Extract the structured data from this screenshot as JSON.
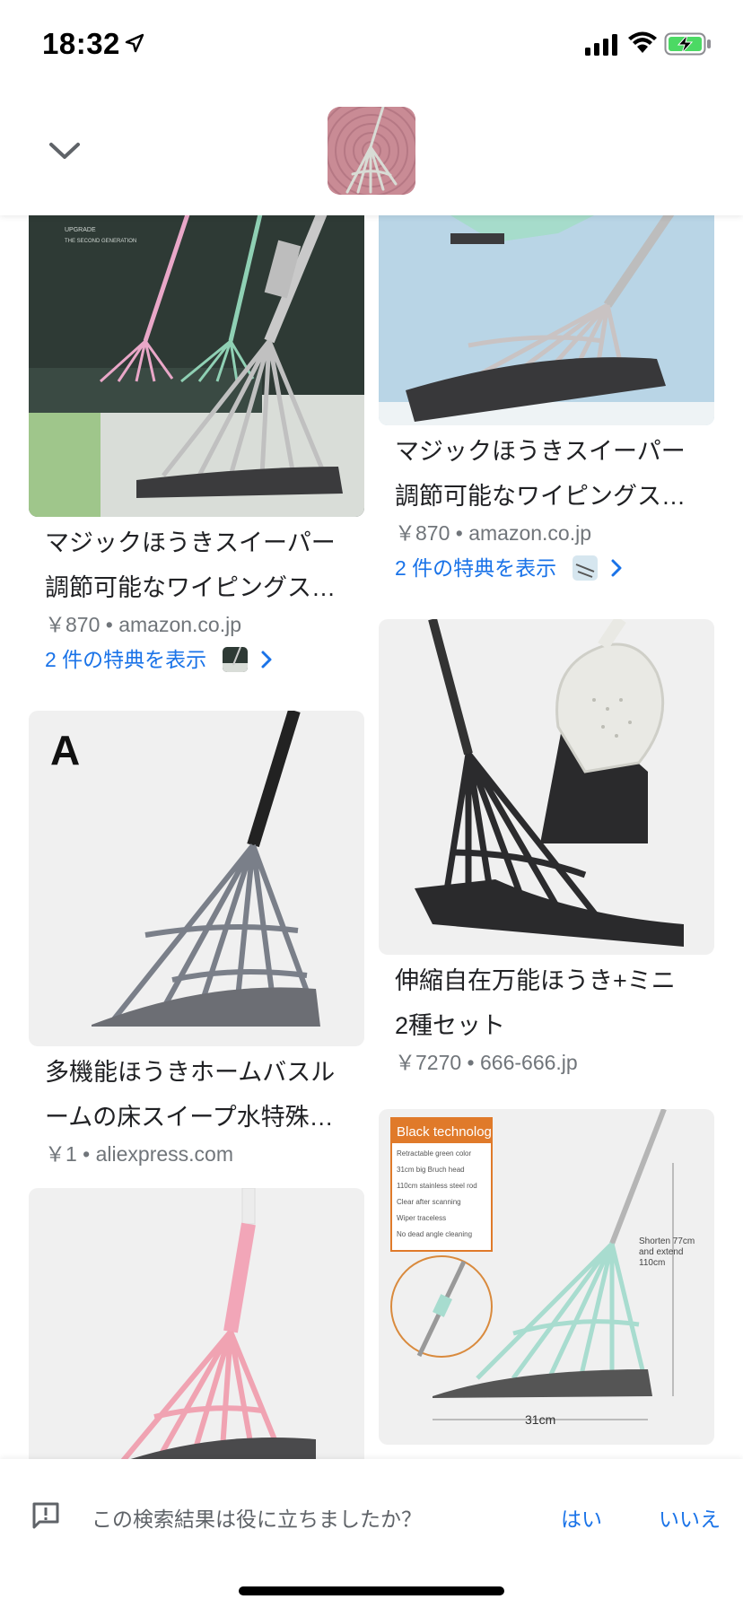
{
  "status_bar": {
    "time": "18:32",
    "icons": [
      "location-arrow-icon",
      "cellular-signal-icon",
      "wifi-icon",
      "battery-charging-icon"
    ],
    "battery_color": "#4cd964"
  },
  "header": {
    "collapse_icon": "chevron-down-icon",
    "thumbnail": "search-image-thumbnail"
  },
  "results": [
    {
      "title_line1": "マジックほうきスイーパー",
      "title_line2": "調節可能なワイピングス…",
      "meta": "￥870 • amazon.co.jp",
      "offer": "2 件の特典を表示"
    },
    {
      "title_line1": "マジックほうきスイーパー",
      "title_line2": "調節可能なワイピングス…",
      "meta": "￥870 • amazon.co.jp",
      "offer": "2 件の特典を表示"
    },
    {
      "title_line1": "多機能ほうきホームバスル",
      "title_line2": "ームの床スイープ水特殊…",
      "meta": "￥1 • aliexpress.com",
      "image_letter": "A"
    },
    {
      "title_line1": "伸縮自在万能ほうき+ミニ",
      "title_line2": "2種セット",
      "meta": "￥7270 • 666-666.jp"
    },
    {
      "title_line1": "",
      "title_line2": "",
      "meta": ""
    },
    {
      "image_text": {
        "heading": "Black technolog",
        "features": [
          "Retractable green color",
          "31cm big Bruch head",
          "110cm stainless steel rod",
          "Clear after scanning",
          "Wiper traceless",
          "No dead angle cleaning"
        ],
        "side_note": [
          "Shorten 77cm",
          "and extend",
          "110cm"
        ],
        "dimension": "31cm"
      }
    }
  ],
  "feedback": {
    "icon": "feedback-icon",
    "question": "この検索結果は役に立ちましたか？",
    "yes": "はい",
    "no": "いいえ"
  },
  "colors": {
    "link": "#1a73e8",
    "meta": "#70757a",
    "title": "#202124"
  }
}
